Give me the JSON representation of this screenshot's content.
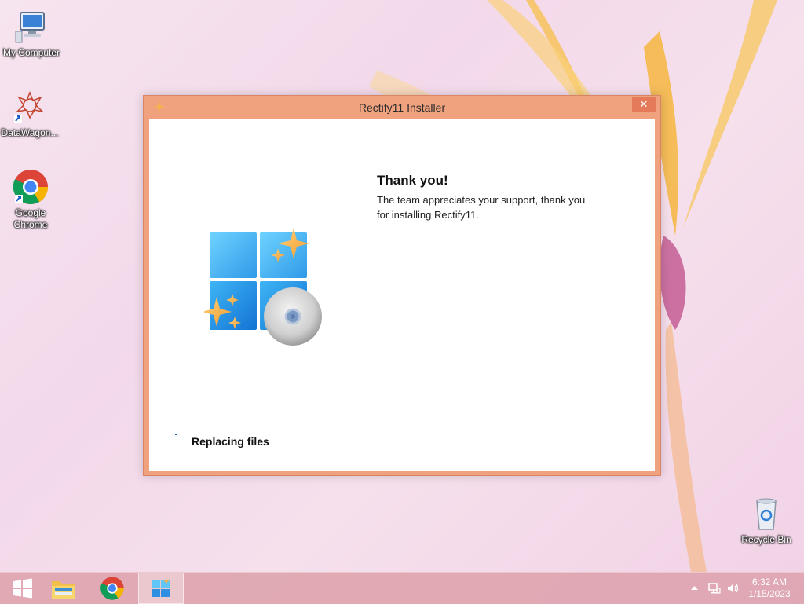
{
  "desktop": {
    "icons": [
      {
        "label": "My Computer"
      },
      {
        "label": "DataWagon..."
      },
      {
        "label": "Google Chrome"
      },
      {
        "label": "Recycle Bin"
      }
    ]
  },
  "window": {
    "title": "Rectify11 Installer",
    "close_label": "✕",
    "heading": "Thank you!",
    "message": "The team appreciates your support, thank you for installing Rectify11.",
    "status": "Replacing files"
  },
  "taskbar": {
    "items": [
      {
        "icon": "windows-start-icon"
      },
      {
        "icon": "file-explorer-icon"
      },
      {
        "icon": "chrome-icon"
      },
      {
        "icon": "rectify11-installer-icon",
        "active": true
      }
    ],
    "clock_time": "6:32 AM",
    "clock_date": "1/15/2023",
    "tray_icons": [
      "show-hidden-icons-icon",
      "network-icon",
      "volume-icon"
    ]
  },
  "colors": {
    "window_frame": "#f0a27f",
    "accent": "#1a5ec7"
  }
}
